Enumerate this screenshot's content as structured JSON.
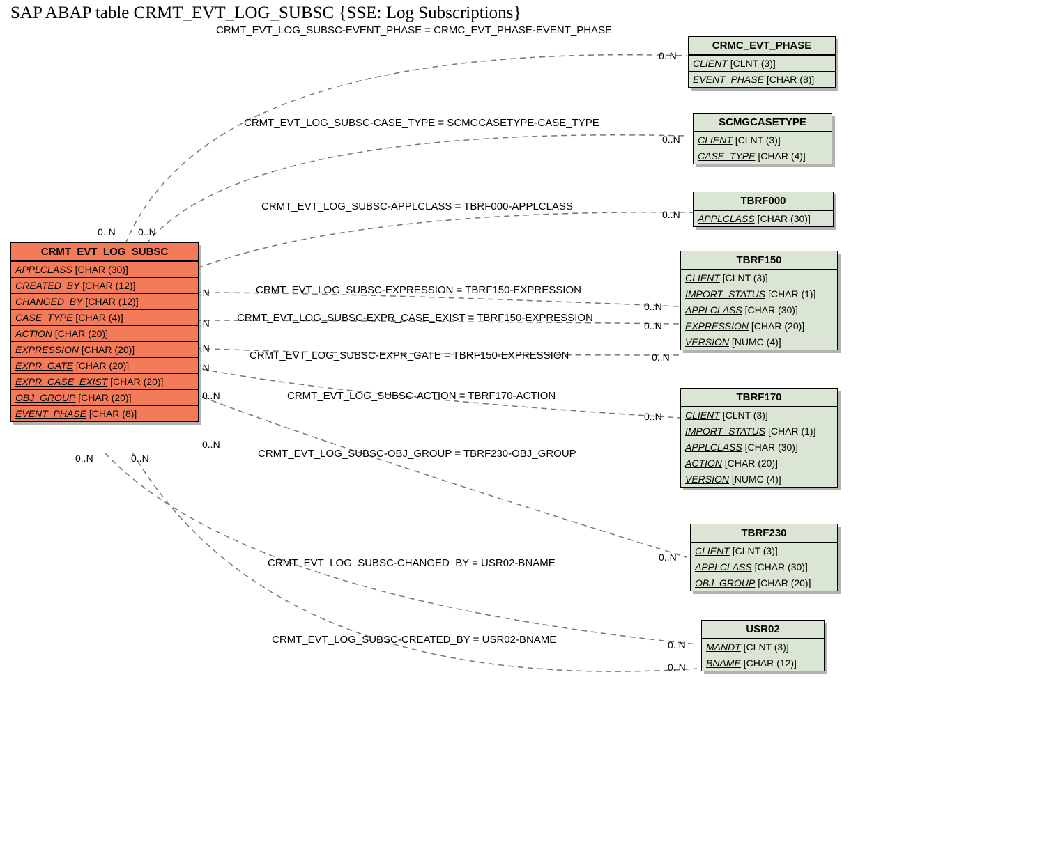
{
  "title": "SAP ABAP table CRMT_EVT_LOG_SUBSC {SSE: Log Subscriptions}",
  "main": {
    "name": "CRMT_EVT_LOG_SUBSC",
    "fields": [
      {
        "name": "APPLCLASS",
        "type": "[CHAR (30)]"
      },
      {
        "name": "CREATED_BY",
        "type": "[CHAR (12)]"
      },
      {
        "name": "CHANGED_BY",
        "type": "[CHAR (12)]"
      },
      {
        "name": "CASE_TYPE",
        "type": "[CHAR (4)]"
      },
      {
        "name": "ACTION",
        "type": "[CHAR (20)]"
      },
      {
        "name": "EXPRESSION",
        "type": "[CHAR (20)]"
      },
      {
        "name": "EXPR_GATE",
        "type": "[CHAR (20)]"
      },
      {
        "name": "EXPR_CASE_EXIST",
        "type": "[CHAR (20)]"
      },
      {
        "name": "OBJ_GROUP",
        "type": "[CHAR (20)]"
      },
      {
        "name": "EVENT_PHASE",
        "type": "[CHAR (8)]"
      }
    ]
  },
  "right": [
    {
      "id": "crmc",
      "name": "CRMC_EVT_PHASE",
      "fields": [
        {
          "name": "CLIENT",
          "type": "[CLNT (3)]"
        },
        {
          "name": "EVENT_PHASE",
          "type": "[CHAR (8)]"
        }
      ]
    },
    {
      "id": "scmg",
      "name": "SCMGCASETYPE",
      "fields": [
        {
          "name": "CLIENT",
          "type": "[CLNT (3)]"
        },
        {
          "name": "CASE_TYPE",
          "type": "[CHAR (4)]"
        }
      ]
    },
    {
      "id": "tbrf000",
      "name": "TBRF000",
      "fields": [
        {
          "name": "APPLCLASS",
          "type": "[CHAR (30)]"
        }
      ]
    },
    {
      "id": "tbrf150",
      "name": "TBRF150",
      "fields": [
        {
          "name": "CLIENT",
          "type": "[CLNT (3)]"
        },
        {
          "name": "IMPORT_STATUS",
          "type": "[CHAR (1)]"
        },
        {
          "name": "APPLCLASS",
          "type": "[CHAR (30)]"
        },
        {
          "name": "EXPRESSION",
          "type": "[CHAR (20)]"
        },
        {
          "name": "VERSION",
          "type": "[NUMC (4)]"
        }
      ]
    },
    {
      "id": "tbrf170",
      "name": "TBRF170",
      "fields": [
        {
          "name": "CLIENT",
          "type": "[CLNT (3)]"
        },
        {
          "name": "IMPORT_STATUS",
          "type": "[CHAR (1)]"
        },
        {
          "name": "APPLCLASS",
          "type": "[CHAR (30)]"
        },
        {
          "name": "ACTION",
          "type": "[CHAR (20)]"
        },
        {
          "name": "VERSION",
          "type": "[NUMC (4)]"
        }
      ]
    },
    {
      "id": "tbrf230",
      "name": "TBRF230",
      "fields": [
        {
          "name": "CLIENT",
          "type": "[CLNT (3)]"
        },
        {
          "name": "APPLCLASS",
          "type": "[CHAR (30)]"
        },
        {
          "name": "OBJ_GROUP",
          "type": "[CHAR (20)]"
        }
      ]
    },
    {
      "id": "usr02",
      "name": "USR02",
      "fields": [
        {
          "name": "MANDT",
          "type": "[CLNT (3)]"
        },
        {
          "name": "BNAME",
          "type": "[CHAR (12)]"
        }
      ]
    }
  ],
  "relations": [
    {
      "text": "CRMT_EVT_LOG_SUBSC-EVENT_PHASE = CRMC_EVT_PHASE-EVENT_PHASE"
    },
    {
      "text": "CRMT_EVT_LOG_SUBSC-CASE_TYPE = SCMGCASETYPE-CASE_TYPE"
    },
    {
      "text": "CRMT_EVT_LOG_SUBSC-APPLCLASS = TBRF000-APPLCLASS"
    },
    {
      "text": "CRMT_EVT_LOG_SUBSC-EXPRESSION = TBRF150-EXPRESSION"
    },
    {
      "text": "CRMT_EVT_LOG_SUBSC-EXPR_CASE_EXIST = TBRF150-EXPRESSION"
    },
    {
      "text": "CRMT_EVT_LOG_SUBSC-EXPR_GATE = TBRF150-EXPRESSION"
    },
    {
      "text": "CRMT_EVT_LOG_SUBSC-ACTION = TBRF170-ACTION"
    },
    {
      "text": "CRMT_EVT_LOG_SUBSC-OBJ_GROUP = TBRF230-OBJ_GROUP"
    },
    {
      "text": "CRMT_EVT_LOG_SUBSC-CHANGED_BY = USR02-BNAME"
    },
    {
      "text": "CRMT_EVT_LOG_SUBSC-CREATED_BY = USR02-BNAME"
    }
  ],
  "cards": {
    "zn": "0..N"
  }
}
